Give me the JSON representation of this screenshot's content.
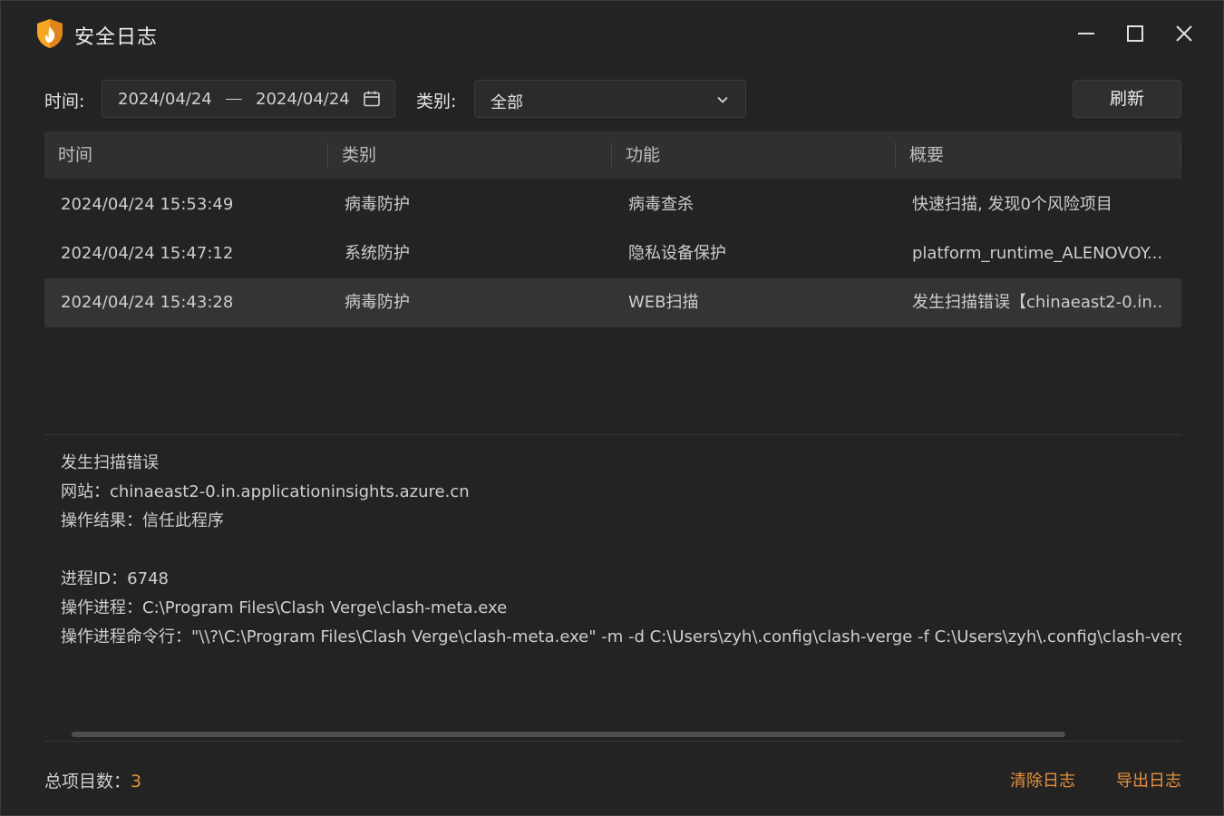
{
  "window": {
    "title": "安全日志"
  },
  "toolbar": {
    "time_label": "时间:",
    "date_start": "2024/04/24",
    "date_end": "2024/04/24",
    "category_label": "类别:",
    "category_value": "全部",
    "refresh_label": "刷新"
  },
  "table": {
    "headers": [
      "时间",
      "类别",
      "功能",
      "概要"
    ],
    "rows": [
      {
        "time": "2024/04/24 15:53:49",
        "category": "病毒防护",
        "function": "病毒查杀",
        "summary": "快速扫描, 发现0个风险项目"
      },
      {
        "time": "2024/04/24 15:47:12",
        "category": "系统防护",
        "function": "隐私设备保护",
        "summary": "platform_runtime_ALENOVOY..."
      },
      {
        "time": "2024/04/24 15:43:28",
        "category": "病毒防护",
        "function": "WEB扫描",
        "summary": "发生扫描错误【chinaeast2-0.in...."
      }
    ],
    "selected_index": 2
  },
  "detail": {
    "lines": [
      "发生扫描错误",
      "网站：chinaeast2-0.in.applicationinsights.azure.cn",
      "操作结果：信任此程序",
      "",
      "进程ID：6748",
      "操作进程：C:\\Program Files\\Clash Verge\\clash-meta.exe",
      "操作进程命令行：\"\\\\?\\C:\\Program Files\\Clash Verge\\clash-meta.exe\" -m -d C:\\Users\\zyh\\.config\\clash-verge -f C:\\Users\\zyh\\.config\\clash-verge\\clash-verge.yaml"
    ]
  },
  "footer": {
    "count_label": "总项目数：",
    "count_value": "3",
    "clear_label": "清除日志",
    "export_label": "导出日志"
  },
  "colors": {
    "accent": "#e8913c",
    "background": "#232323",
    "header_bg": "#303030",
    "selected_row_bg": "#343434"
  },
  "icons": {
    "logo": "shield-flame-icon",
    "minimize": "minimize-icon",
    "maximize": "maximize-icon",
    "close": "close-icon",
    "calendar": "calendar-icon",
    "dropdown": "chevron-down-icon"
  }
}
